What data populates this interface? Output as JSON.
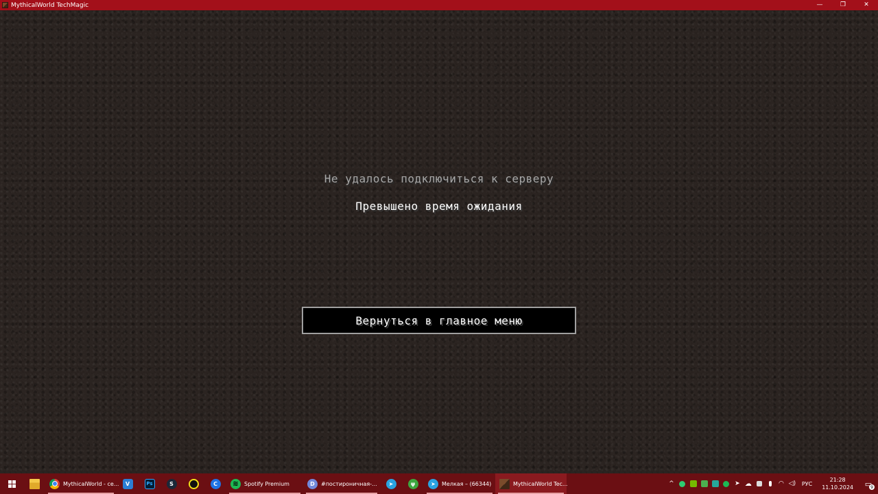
{
  "window": {
    "title": "MythicalWorld TechMagic",
    "controls": {
      "minimize": "—",
      "maximize": "❐",
      "close": "✕"
    }
  },
  "screen": {
    "title": "Не удалось подключиться к серверу",
    "reason": "Превышено время ожидания",
    "back_button": "Вернуться в главное меню"
  },
  "taskbar": {
    "apps": [
      {
        "label": "MythicalWorld - се...",
        "icon": "chrome-icon"
      },
      {
        "label": "Spotify Premium",
        "icon": "spotify-icon"
      },
      {
        "label": "#постироничная-...",
        "icon": "discord-icon"
      },
      {
        "label": "Мелкая – (66344)",
        "icon": "telegram-icon"
      },
      {
        "label": "MythicalWorld Tec...",
        "icon": "minecraft-icon"
      }
    ],
    "icons": {
      "vscode": "V",
      "photoshop": "Ps",
      "steam": "S",
      "blue": "C",
      "spotify": "≋",
      "discord": "D",
      "telegram": "➤",
      "leaf": "ψ"
    },
    "tray": {
      "chevron": "^",
      "language": "РУС",
      "time": "21:28",
      "date": "11.10.2024",
      "notifications": "9"
    }
  },
  "colors": {
    "titlebar": "#a3101a",
    "taskbar": "#6b0f13",
    "background": "#2b2421",
    "button_border": "#a0a0a0"
  }
}
